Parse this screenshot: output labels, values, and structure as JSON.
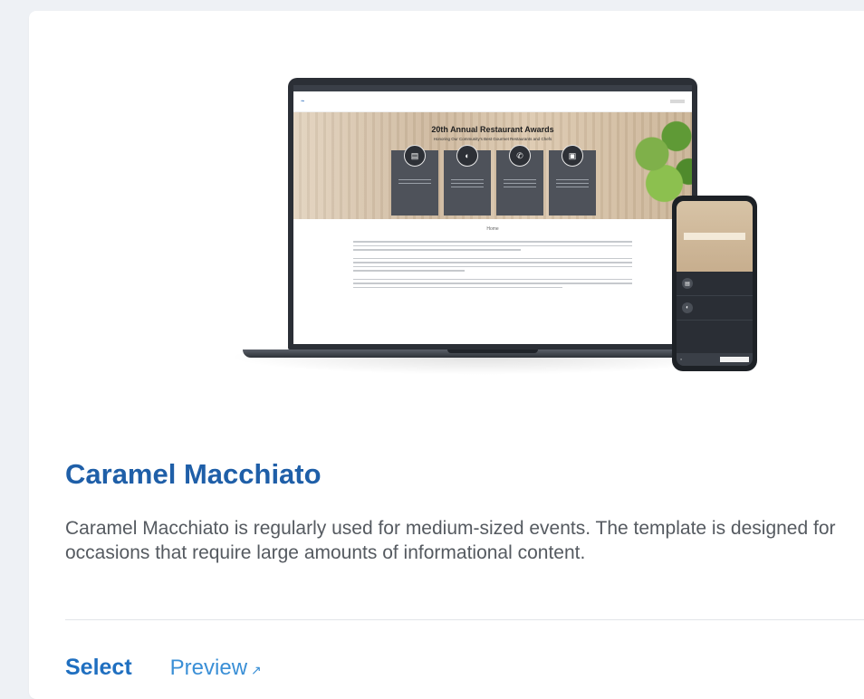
{
  "template": {
    "name": "Caramel Macchiato",
    "description": "Caramel Macchiato is regularly used for medium-sized events. The template is designed for occasions that require large amounts of informational content.",
    "actions": {
      "select_label": "Select",
      "preview_label": "Preview",
      "preview_icon": "external-link-icon"
    }
  },
  "preview": {
    "site_title": "20th Annual Restaurant Awards",
    "site_subtitle": "Honoring Our Community's Best Gourmet Restaurants and Chefs",
    "page_heading": "Home"
  },
  "colors": {
    "title": "#1f5fa8",
    "link": "#1f6fc0",
    "text": "#555a60",
    "background": "#eef1f5"
  }
}
